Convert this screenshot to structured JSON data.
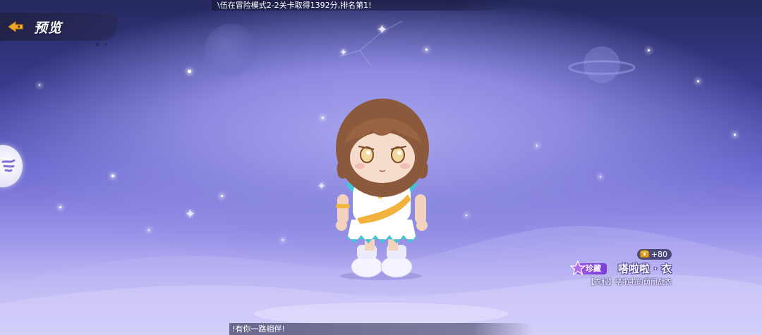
{
  "header": {
    "title": "预览"
  },
  "tickers": {
    "top": "\\伍在冒险模式2-2关卡取得1392分,排名第1!",
    "bottom": "!有你一路相伴!"
  },
  "item": {
    "bonus": "+80",
    "rarity": "珍藏",
    "name": "嗒啦啦 · 衣",
    "description": "【衣服】嗒啦啦的萌丽战衣"
  },
  "colors": {
    "rarity_tag": "#8a4ad9",
    "back_icon": "#f2a62a",
    "sky_top": "#25295e",
    "sky_bottom": "#d9d2f8"
  },
  "icons": {
    "back": "back-arrow-icon",
    "bonus": "treasure-chest-icon",
    "rarity": "rarity-star-icon",
    "side": "side-menu-icon"
  }
}
